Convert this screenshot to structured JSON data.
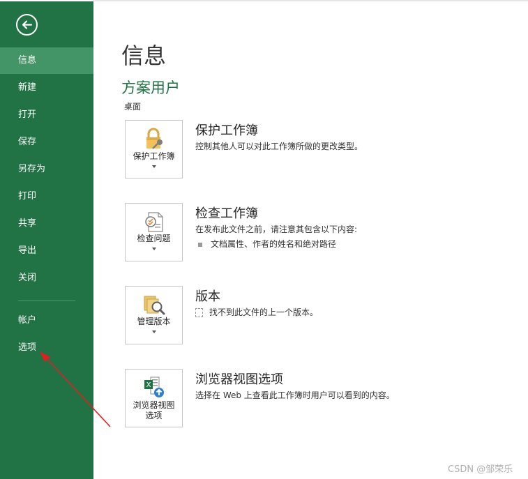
{
  "sidebar": {
    "items": [
      {
        "label": "信息",
        "active": true
      },
      {
        "label": "新建"
      },
      {
        "label": "打开"
      },
      {
        "label": "保存"
      },
      {
        "label": "另存为"
      },
      {
        "label": "打印"
      },
      {
        "label": "共享"
      },
      {
        "label": "导出"
      },
      {
        "label": "关闭"
      }
    ],
    "bottom_items": [
      {
        "label": "帐户"
      },
      {
        "label": "选项"
      }
    ],
    "bg_color": "#217346",
    "active_color": "#439467"
  },
  "main": {
    "title": "信息",
    "doc_name": "方案用户",
    "doc_location": "桌面",
    "sections": [
      {
        "tile_label": "保护工作簿",
        "tile_icon": "lock-key-icon",
        "title": "保护工作簿",
        "desc": "控制其他人可以对此工作簿所做的更改类型。"
      },
      {
        "tile_label": "检查问题",
        "tile_icon": "inspect-document-icon",
        "title": "检查工作簿",
        "desc": "在发布此文件之前，请注意其包含以下内容:",
        "bullet": "文档属性、作者的姓名和绝对路径"
      },
      {
        "tile_label": "管理版本",
        "tile_icon": "manage-versions-icon",
        "title": "版本",
        "desc": "找不到此文件的上一个版本。"
      },
      {
        "tile_label_line1": "浏览器视图",
        "tile_label_line2": "选项",
        "tile_icon": "excel-browser-icon",
        "title": "浏览器视图选项",
        "desc": "选择在 Web 上查看此工作簿时用户可以看到的内容。"
      }
    ]
  },
  "watermark": "CSDN @邹荣乐"
}
